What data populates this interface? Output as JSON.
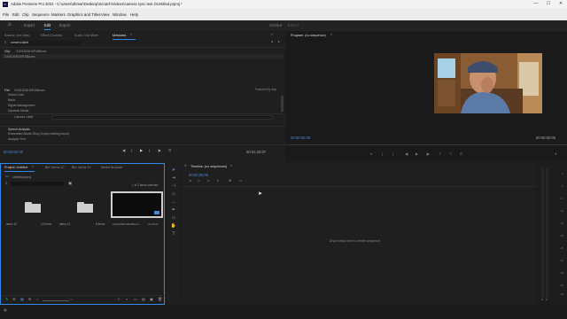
{
  "window": {
    "title": "Adobe Premiere Pro 2022 - C:\\Users\\Zbmar\\Desktop\\Scratch\\Videos\\camera sync test 2\\Untitled.prproj *",
    "app_icon": "Pr",
    "minimize": "—",
    "maximize": "☐",
    "close": "✕"
  },
  "menu": [
    "File",
    "Edit",
    "Clip",
    "Sequence",
    "Markers",
    "Graphics and Titles",
    "View",
    "Window",
    "Help"
  ],
  "workspaces": {
    "home_icon": "home-icon",
    "import": "Import",
    "edit": "Edit",
    "export": "Export",
    "center_title": "Untitled",
    "center_sub": "Edited"
  },
  "source_panel": {
    "tabs": [
      "Source: (no clips)",
      "Effect Controls",
      "Audio Clip Mixer",
      "Metadata"
    ],
    "active_tab": "Metadata",
    "search_value": "camera label",
    "clip_label": "Clip:",
    "clip_name": "GX011536.MP4/Bloom",
    "clip_row": "GX011536.MP4/Bloom",
    "file_label": "File:",
    "file_name": "GX011536.MP4/Bloom",
    "xmp_logo": "Powered By xmp",
    "rows": [
      "Dublin Core",
      "Basic",
      "Rights Management",
      "Dynamic Media"
    ],
    "camera_label": "Camera Label",
    "speech_heading": "Speech Analysis",
    "speech_rows": [
      "Embedded Adobe Story Script (nothing found)",
      "Analysis Text"
    ],
    "timecode_left": "00:00:00:00",
    "timecode_right": "00:31:33:07"
  },
  "program_panel": {
    "title": "Program: (no sequence)",
    "tc_left": "00:00:00:00",
    "tc_right": "00:00:00:00"
  },
  "project_panel": {
    "tabs": [
      "Project: Untitled",
      "Bin: Items 12",
      "Bin: Items 10",
      "Media Browser"
    ],
    "project_file": "Untitled.prproj",
    "selection_info": "1 of 3 items selected",
    "bins": [
      {
        "name": "Items 10",
        "count": "10 Items"
      },
      {
        "name": "Items 12",
        "count": "8 Items"
      }
    ],
    "clip": {
      "name": "GX011536.MP4/Bloom",
      "duration": "31:33:07"
    }
  },
  "timeline_panel": {
    "title": "Timeline: (no sequences)",
    "timecode": "00;00;00;00",
    "drop_text": "Drop media here to create sequence."
  },
  "meter": {
    "ticks": [
      "0",
      "-6",
      "-12",
      "-18",
      "-24",
      "-30",
      "-36",
      "-42",
      "-48",
      "-54",
      "dB"
    ],
    "solo_labels": [
      "S",
      "S"
    ]
  },
  "icons": {
    "search": "⌕",
    "filter": "≡",
    "play": "▶",
    "step_back": "◀|",
    "step_fwd": "|▶",
    "mark_in": "{",
    "mark_out": "}",
    "camera": "⊡",
    "plus": "+",
    "settings": "⚙",
    "pencil": "✎"
  },
  "colors": {
    "accent": "#2d8ceb",
    "timecode": "#4a86d8",
    "panel_bg": "#1f1f1f",
    "app_bg": "#1d1d1d"
  }
}
